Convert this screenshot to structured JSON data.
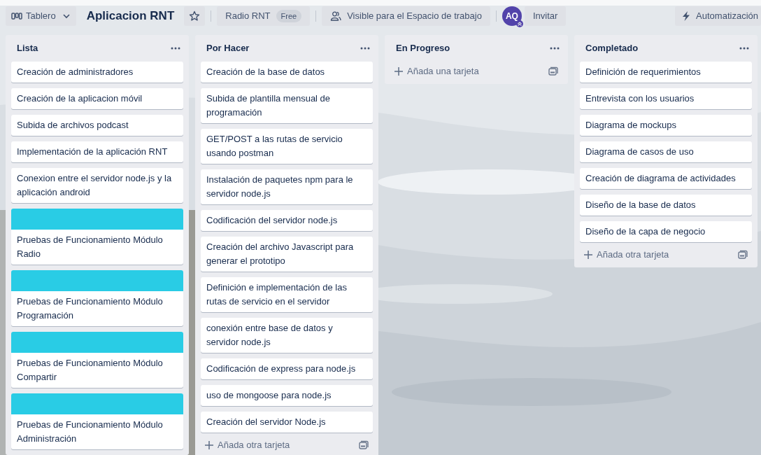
{
  "top_bar": {
    "view_button": "Tablero",
    "board_title": "Aplicacion RNT",
    "starred": false,
    "workspace": {
      "name": "Radio RNT",
      "badge": "Free"
    },
    "visibility": "Visible para el Espacio de trabajo",
    "member": {
      "initials": "AQ",
      "color": "#5243aa"
    },
    "invite": "Invitar",
    "automation": "Automatización"
  },
  "lists": [
    {
      "title": "Lista",
      "cards": [
        {
          "title": "Creación de administradores"
        },
        {
          "title": "Creación de la aplicacion móvil"
        },
        {
          "title": "Subida de archivos podcast"
        },
        {
          "title": "Implementación de la aplicación RNT"
        },
        {
          "title": "Conexion entre el servidor node.js y la aplicación android"
        },
        {
          "title": "Pruebas de Funcionamiento Módulo Radio",
          "color": "#29cce5"
        },
        {
          "title": "Pruebas de Funcionamiento Módulo Programación",
          "color": "#29cce5"
        },
        {
          "title": "Pruebas de Funcionamiento Módulo Compartir",
          "color": "#29cce5"
        },
        {
          "title": "Pruebas de Funcionamiento Módulo Administración",
          "color": "#29cce5"
        }
      ]
    },
    {
      "title": "Por Hacer",
      "cards": [
        {
          "title": "Creación de la base de datos"
        },
        {
          "title": "Subida de plantilla mensual de programación"
        },
        {
          "title": "GET/POST a las rutas de servicio usando postman"
        },
        {
          "title": "Instalación de paquetes npm para le servidor node.js"
        },
        {
          "title": "Codificación del servidor node.js"
        },
        {
          "title": "Creación del archivo Javascript para generar el prototipo"
        },
        {
          "title": "Definición e implementación de las rutas de servicio en el servidor"
        },
        {
          "title": "conexión entre base de datos y servidor node.js"
        },
        {
          "title": "Codificación de express para node.js"
        },
        {
          "title": "uso de mongoose para node.js"
        },
        {
          "title": "Creación del servidor Node.js"
        }
      ],
      "add_label": "Añada otra tarjeta"
    },
    {
      "title": "En Progreso",
      "add_label": "Añada una tarjeta"
    },
    {
      "title": "Completado",
      "cards": [
        {
          "title": "Definición de requerimientos"
        },
        {
          "title": "Entrevista con los usuarios"
        },
        {
          "title": "Diagrama de mockups"
        },
        {
          "title": "Diagrama de casos de uso"
        },
        {
          "title": "Creación de diagrama de actividades"
        },
        {
          "title": "Diseño de la base de datos"
        },
        {
          "title": "Diseño de la capa de negocio"
        }
      ],
      "add_label": "Añada otra tarjeta"
    }
  ]
}
